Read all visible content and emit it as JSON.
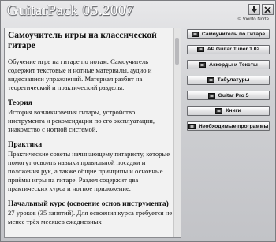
{
  "window": {
    "title": "GuitarPack 05.2007",
    "copyright": "© Viento Norte",
    "download_icon": "download-icon",
    "close_icon": "close-icon"
  },
  "content": {
    "heading": "Самоучитель игры на классической гитаре",
    "intro": "Обучение игре на гитаре по нотам. Самоучитель содержит текстовые и нотные материалы, аудио и видеозаписи упражнений. Материал разбит на теоретический и практический разделы.",
    "sections": [
      {
        "title": "Теория",
        "text": "История возникновения гитары, устройство инструмента и рекомендации по его эксплуатации, знакомство с нотной системой."
      },
      {
        "title": "Практика",
        "text": "Практические советы начинающему гитаристу, которые помогут освоить навыки правильной посадки и положения рук, а также общие принципы и основные приёмы игры на гитаре. Раздел содержит два практических курса и нотное приложение."
      },
      {
        "title": "Начальный курс (освоение основ инструмента)",
        "text": "27 уроков (35 занятий). Для освоения курса требуется не менее трёх месяцев ежедневных"
      }
    ]
  },
  "nav": {
    "items": [
      {
        "label": "Самоучитель по Гитаре",
        "icon": "film-icon"
      },
      {
        "label": "AP Guitar Tuner 1.02",
        "icon": "film-icon"
      },
      {
        "label": "Аккорды и Тексты",
        "icon": "film-icon"
      },
      {
        "label": "Табулатуры",
        "icon": "film-icon"
      },
      {
        "label": "Guitar Pro 5",
        "icon": "film-icon"
      },
      {
        "label": "Книги",
        "icon": "film-icon"
      },
      {
        "label": "Необходимые программы",
        "icon": "film-icon"
      }
    ]
  },
  "colors": {
    "frame": "#cfd0d3",
    "content_bg": "#f2f2f2",
    "button_border": "#6a6b6f"
  }
}
